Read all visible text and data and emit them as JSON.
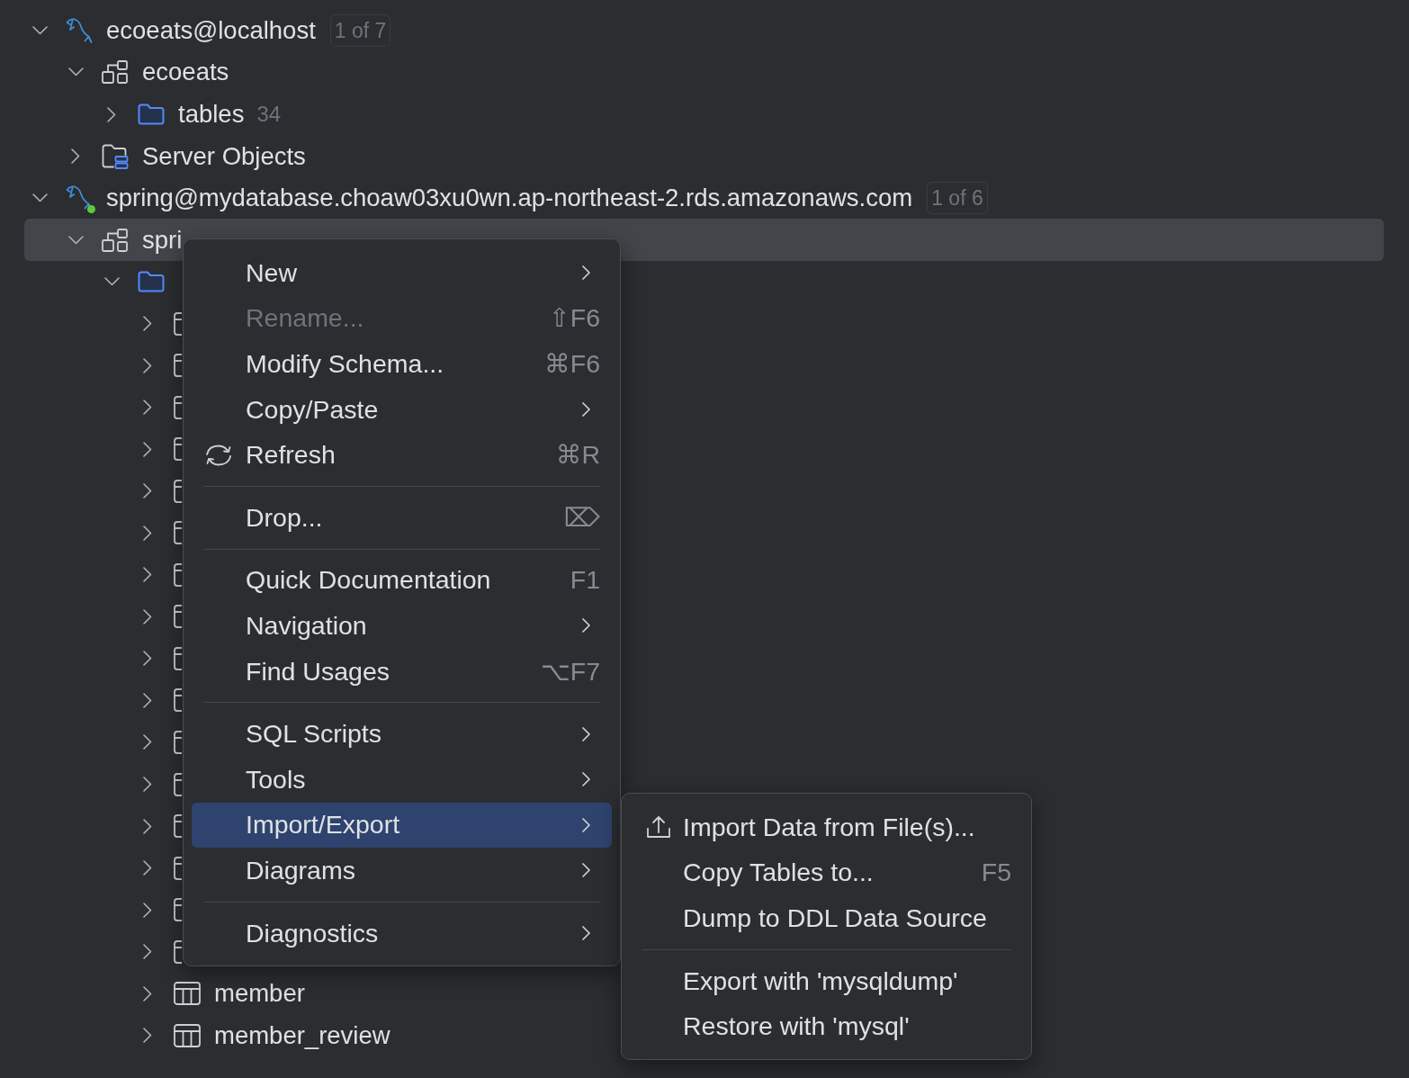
{
  "tree": [
    {
      "kind": "datasource",
      "label": "ecoeats@localhost",
      "badge": "1 of 7",
      "connected": false,
      "expanded": true,
      "selected": false,
      "children": [
        {
          "kind": "schema",
          "label": "ecoeats",
          "expanded": true,
          "selected": false,
          "children": [
            {
              "kind": "folder",
              "label": "tables",
              "count": "34",
              "expanded": false,
              "selected": false
            }
          ]
        },
        {
          "kind": "server-objects",
          "label": "Server Objects",
          "expanded": false,
          "selected": false
        }
      ]
    },
    {
      "kind": "datasource",
      "label": "spring@mydatabase.choaw03xu0wn.ap-northeast-2.rds.amazonaws.com",
      "badge": "1 of 6",
      "connected": true,
      "expanded": true,
      "selected": false,
      "children": [
        {
          "kind": "schema",
          "label": "spri",
          "expanded": true,
          "selected": true,
          "children": [
            {
              "kind": "folder",
              "expanded": true,
              "selected": false,
              "children": [
                {
                  "kind": "table",
                  "expanded": false,
                  "selected": false
                },
                {
                  "kind": "table",
                  "expanded": false,
                  "selected": false
                },
                {
                  "kind": "table",
                  "expanded": false,
                  "selected": false
                },
                {
                  "kind": "table",
                  "expanded": false,
                  "selected": false
                },
                {
                  "kind": "table",
                  "expanded": false,
                  "selected": false
                },
                {
                  "kind": "table",
                  "expanded": false,
                  "selected": false
                },
                {
                  "kind": "table",
                  "expanded": false,
                  "selected": false
                },
                {
                  "kind": "table",
                  "expanded": false,
                  "selected": false
                },
                {
                  "kind": "table",
                  "expanded": false,
                  "selected": false
                },
                {
                  "kind": "table",
                  "expanded": false,
                  "selected": false
                },
                {
                  "kind": "table",
                  "expanded": false,
                  "selected": false
                },
                {
                  "kind": "table",
                  "expanded": false,
                  "selected": false
                },
                {
                  "kind": "table",
                  "expanded": false,
                  "selected": false
                },
                {
                  "kind": "table",
                  "expanded": false,
                  "selected": false
                },
                {
                  "kind": "table",
                  "expanded": false,
                  "selected": false
                },
                {
                  "kind": "table",
                  "expanded": false,
                  "selected": false
                },
                {
                  "kind": "table",
                  "label": "member",
                  "expanded": false,
                  "selected": false
                },
                {
                  "kind": "table",
                  "label": "member_review",
                  "expanded": false,
                  "selected": false
                }
              ]
            }
          ]
        }
      ]
    }
  ],
  "context_menu": {
    "items": [
      {
        "kind": "item",
        "label": "New",
        "has_submenu": true,
        "disabled": false,
        "selected": false
      },
      {
        "kind": "item",
        "label": "Rename...",
        "shortcut": "⇧F6",
        "has_submenu": false,
        "disabled": true,
        "selected": false
      },
      {
        "kind": "item",
        "label": "Modify Schema...",
        "shortcut": "⌘F6",
        "has_submenu": false,
        "disabled": false,
        "selected": false
      },
      {
        "kind": "item",
        "label": "Copy/Paste",
        "has_submenu": true,
        "disabled": false,
        "selected": false
      },
      {
        "kind": "icon-item",
        "label": "Refresh",
        "shortcut": "⌘R",
        "has_submenu": false,
        "disabled": false,
        "selected": false
      },
      {
        "kind": "separator"
      },
      {
        "kind": "item",
        "label": "Drop...",
        "shortcut": "⌦",
        "has_submenu": false,
        "disabled": false,
        "selected": false
      },
      {
        "kind": "separator"
      },
      {
        "kind": "item",
        "label": "Quick Documentation",
        "shortcut": "F1",
        "has_submenu": false,
        "disabled": false,
        "selected": false
      },
      {
        "kind": "item",
        "label": "Navigation",
        "has_submenu": true,
        "disabled": false,
        "selected": false
      },
      {
        "kind": "item",
        "label": "Find Usages",
        "shortcut": "⌥F7",
        "has_submenu": false,
        "disabled": false,
        "selected": false
      },
      {
        "kind": "separator"
      },
      {
        "kind": "item",
        "label": "SQL Scripts",
        "has_submenu": true,
        "disabled": false,
        "selected": false
      },
      {
        "kind": "item",
        "label": "Tools",
        "has_submenu": true,
        "disabled": false,
        "selected": false
      },
      {
        "kind": "item",
        "label": "Import/Export",
        "has_submenu": true,
        "disabled": false,
        "selected": true
      },
      {
        "kind": "item",
        "label": "Diagrams",
        "has_submenu": true,
        "disabled": false,
        "selected": false
      },
      {
        "kind": "separator"
      },
      {
        "kind": "item",
        "label": "Diagnostics",
        "has_submenu": true,
        "disabled": false,
        "selected": false
      }
    ]
  },
  "submenu": {
    "items": [
      {
        "kind": "icon-item",
        "label": "Import Data from File(s)...",
        "has_submenu": false,
        "disabled": false,
        "selected": false
      },
      {
        "kind": "item",
        "label": "Copy Tables to...",
        "shortcut": "F5",
        "has_submenu": false,
        "disabled": false,
        "selected": false
      },
      {
        "kind": "item",
        "label": "Dump to DDL Data Source",
        "has_submenu": false,
        "disabled": false,
        "selected": false
      },
      {
        "kind": "separator"
      },
      {
        "kind": "item",
        "label": "Export with 'mysqldump'",
        "has_submenu": false,
        "disabled": false,
        "selected": false
      },
      {
        "kind": "item",
        "label": "Restore with 'mysql'",
        "has_submenu": false,
        "disabled": false,
        "selected": false
      }
    ]
  }
}
